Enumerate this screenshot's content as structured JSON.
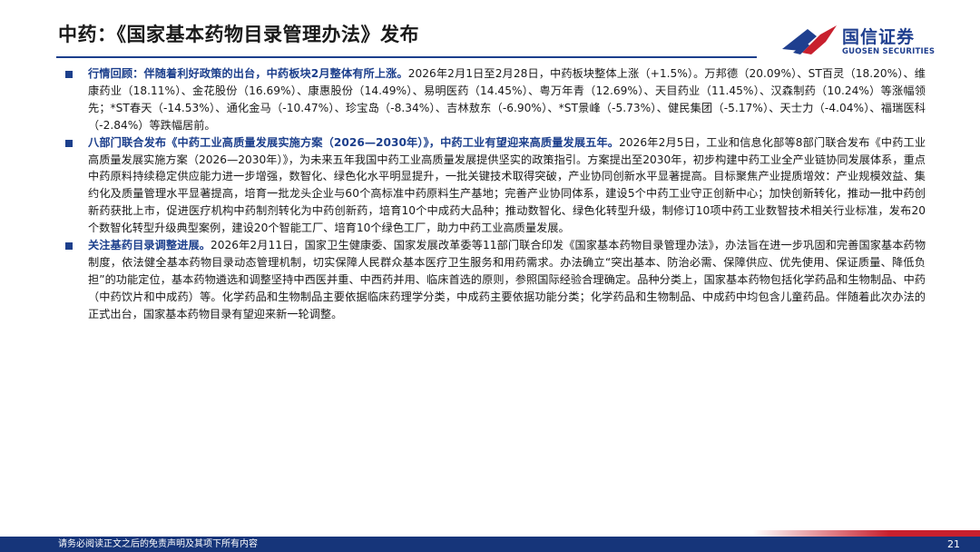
{
  "page": {
    "title": "中药：《国家基本药物目录管理办法》发布",
    "page_number": "21"
  },
  "logo": {
    "name_cn": "国信证券",
    "name_en": "GUOSEN SECURITIES"
  },
  "footer": {
    "disclaimer": "请务必阅读正文之后的免责声明及其项下所有内容"
  },
  "paragraphs": [
    {
      "lead": "行情回顾：伴随着利好政策的出台，中药板块2月整体有所上涨。",
      "body": "2026年2月1日至2月28日，中药板块整体上涨（+1.5%）。万邦德（20.09%）、ST百灵（18.20%）、维康药业（18.11%）、金花股份（16.69%）、康惠股份（14.49%）、易明医药（14.45%）、粤万年青（12.69%）、天目药业（11.45%）、汉森制药（10.24%）等涨幅领先；*ST春天（-14.53%）、通化金马（-10.47%）、珍宝岛（-8.34%）、吉林敖东（-6.90%）、*ST景峰（-5.73%）、健民集团（-5.17%）、天士力（-4.04%）、福瑞医科（-2.84%）等跌幅居前。"
    },
    {
      "lead": "八部门联合发布《中药工业高质量发展实施方案（2026—2030年）》，中药工业有望迎来高质量发展五年。",
      "body": "2026年2月5日，工业和信息化部等8部门联合发布《中药工业高质量发展实施方案（2026—2030年）》，为未来五年我国中药工业高质量发展提供坚实的政策指引。方案提出至2030年，初步构建中药工业全产业链协同发展体系，重点中药原料持续稳定供应能力进一步增强，数智化、绿色化水平明显提升，一批关键技术取得突破，产业协同创新水平显著提高。目标聚焦产业提质增效：产业规模效益、集约化及质量管理水平显著提高，培育一批龙头企业与60个高标准中药原料生产基地；完善产业协同体系，建设5个中药工业守正创新中心；加快创新转化，推动一批中药创新药获批上市，促进医疗机构中药制剂转化为中药创新药，培育10个中成药大品种；推动数智化、绿色化转型升级，制修订10项中药工业数智技术相关行业标准，发布20个数智化转型升级典型案例，建设20个智能工厂、培育10个绿色工厂，助力中药工业高质量发展。"
    },
    {
      "lead": "关注基药目录调整进展。",
      "body": "2026年2月11日，国家卫生健康委、国家发展改革委等11部门联合印发《国家基本药物目录管理办法》，办法旨在进一步巩固和完善国家基本药物制度，依法健全基本药物目录动态管理机制，切实保障人民群众基本医疗卫生服务和用药需求。办法确立“突出基本、防治必需、保障供应、优先使用、保证质量、降低负担”的功能定位，基本药物遴选和调整坚持中西医并重、中西药并用、临床首选的原则，参照国际经验合理确定。品种分类上，国家基本药物包括化学药品和生物制品、中药（中药饮片和中成药）等。化学药品和生物制品主要依据临床药理学分类，中成药主要依据功能分类；化学药品和生物制品、中成药中均包含儿童药品。伴随着此次办法的正式出台，国家基本药物目录有望迎来新一轮调整。"
    }
  ],
  "colors": {
    "brand_blue": "#1c3f8c",
    "brand_red": "#c8202e",
    "text": "#1a1a1a"
  }
}
